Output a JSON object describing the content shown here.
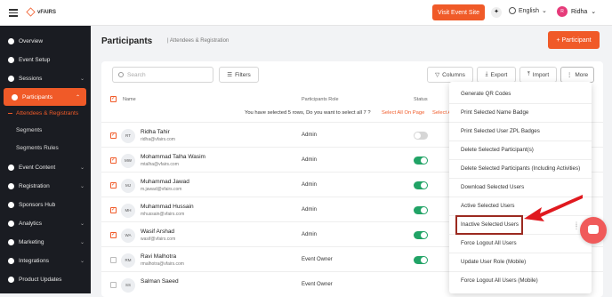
{
  "topbar": {
    "logo_text": "vFAIRS",
    "visit_btn": "Visit Event Site",
    "language": "English",
    "user_initial": "R",
    "user_name": "Ridha"
  },
  "sidebar": {
    "items": [
      {
        "label": "Overview"
      },
      {
        "label": "Event Setup"
      },
      {
        "label": "Sessions"
      },
      {
        "label": "Participants"
      },
      {
        "label": "Event Content"
      },
      {
        "label": "Registration"
      },
      {
        "label": "Sponsors Hub"
      },
      {
        "label": "Analytics"
      },
      {
        "label": "Marketing"
      },
      {
        "label": "Integrations"
      },
      {
        "label": "Product Updates"
      }
    ],
    "subitems": [
      {
        "label": "Attendees & Registrants"
      },
      {
        "label": "Segments"
      },
      {
        "label": "Segments Rules"
      }
    ]
  },
  "page": {
    "title": "Participants",
    "breadcrumb": "| Attendees & Registration",
    "add_btn": "+ Participant"
  },
  "toolbar": {
    "search_placeholder": "Search",
    "filters": "Filters",
    "columns": "Columns",
    "export": "Export",
    "import": "Import",
    "more": "More"
  },
  "table": {
    "headers": {
      "name": "Name",
      "role": "Participants Role",
      "status": "Status"
    },
    "select_note": "You have selected 5 rows, Do you want to select all 7 ?",
    "select_all": "Select All On Page",
    "select_all_2": "Select A",
    "rows": [
      {
        "initials": "RT",
        "name": "Ridha Tahir",
        "email": "ridha@vfairs.com",
        "role": "Admin",
        "checked": true,
        "active": false
      },
      {
        "initials": "MW",
        "name": "Mohammad Talha Wasim",
        "email": "mtalha@vfairs.com",
        "role": "Admin",
        "checked": true,
        "active": true
      },
      {
        "initials": "MJ",
        "name": "Muhammad Jawad",
        "email": "m.jawad@vfairs.com",
        "role": "Admin",
        "checked": true,
        "active": true
      },
      {
        "initials": "MH",
        "name": "Muhammad Hussain",
        "email": "mhussain@vfairs.com",
        "role": "Admin",
        "checked": true,
        "active": true
      },
      {
        "initials": "WA",
        "name": "Wasif Arshad",
        "email": "wasif@vfairs.com",
        "role": "Admin",
        "checked": true,
        "active": true
      },
      {
        "initials": "RM",
        "name": "Ravi Malhotra",
        "email": "rmalhotra@vfairs.com",
        "role": "Event Owner",
        "checked": false,
        "active": true
      },
      {
        "initials": "SS",
        "name": "Salman Saeed",
        "email": "",
        "role": "Event Owner",
        "checked": false,
        "active": true
      }
    ]
  },
  "more_menu": {
    "items": [
      {
        "label": "Generate QR Codes"
      },
      {
        "label": "Print Selected Name Badge"
      },
      {
        "label": "Print Selected User ZPL Badges"
      },
      {
        "label": "Delete Selected Participant(s)"
      },
      {
        "label": "Delete Selected Participants (Including Activities)"
      },
      {
        "label": "Download Selected Users"
      },
      {
        "label": "Active Selected Users"
      },
      {
        "label": "Inactive Selected Users"
      },
      {
        "label": "Force Logout All Users"
      },
      {
        "label": "Update User Role (Mobile)"
      },
      {
        "label": "Force Logout All Users (Mobile)"
      }
    ]
  },
  "colors": {
    "accent": "#f05a28",
    "highlight_box": "#9b2a20",
    "arrow": "#e0191f"
  }
}
